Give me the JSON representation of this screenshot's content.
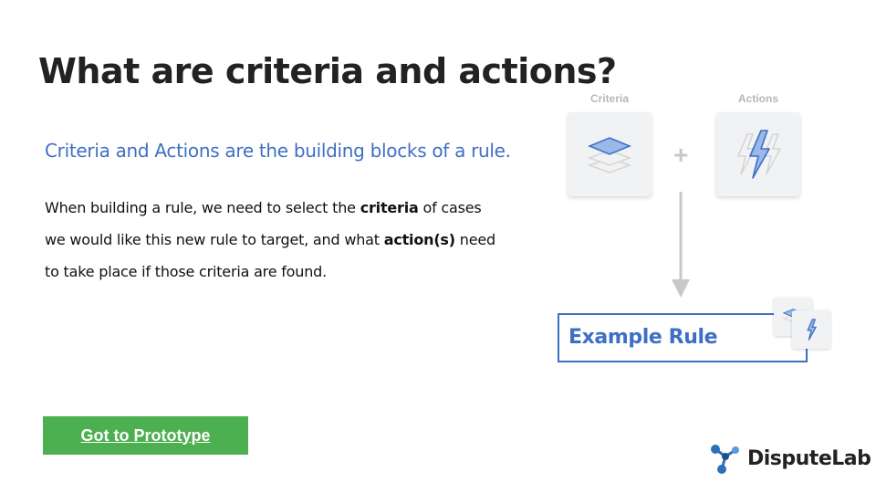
{
  "slide": {
    "title": "What are criteria and actions?",
    "subtitle": "Criteria and Actions are the building blocks of a rule.",
    "body": {
      "part1": "When building a rule, we need to select the ",
      "bold1": "criteria",
      "part2": " of cases we would like this new rule to target, and what ",
      "bold2": "action(s)",
      "part3": " need to take place if those criteria are found."
    },
    "button_label": "Got to Prototype"
  },
  "diagram": {
    "criteria_label": "Criteria",
    "actions_label": "Actions",
    "plus": "+",
    "rule_label": "Example Rule",
    "icons": {
      "criteria": "layers-icon",
      "actions": "lightning-icon"
    },
    "colors": {
      "accent": "#3f6fc4",
      "icon_fill": "#9ab8e8",
      "card_bg": "#f1f2f4"
    }
  },
  "brand": {
    "name": "DisputeLab",
    "logo_color": "#2c6fbb"
  },
  "colors": {
    "button_green": "#4caf50",
    "title_text": "#222222"
  }
}
